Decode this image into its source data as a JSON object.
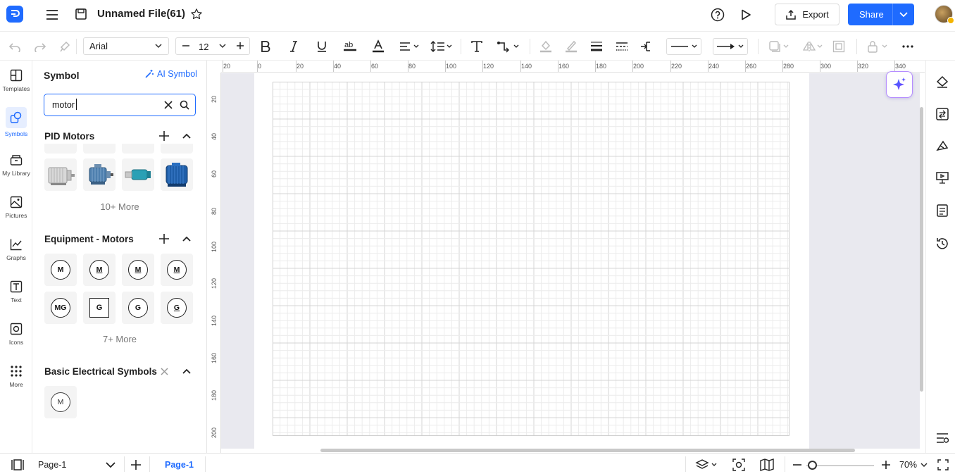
{
  "header": {
    "file_title": "Unnamed File(61)",
    "export_label": "Export",
    "share_label": "Share"
  },
  "toolbar": {
    "font": "Arial",
    "font_size": "12"
  },
  "left_rail": [
    {
      "label": "Templates",
      "icon": "templates-icon"
    },
    {
      "label": "Symbols",
      "icon": "symbols-icon",
      "active": true
    },
    {
      "label": "My Library",
      "icon": "library-icon"
    },
    {
      "label": "Pictures",
      "icon": "pictures-icon"
    },
    {
      "label": "Graphs",
      "icon": "graphs-icon"
    },
    {
      "label": "Text",
      "icon": "text-icon"
    },
    {
      "label": "Icons",
      "icon": "icons-icon"
    },
    {
      "label": "More",
      "icon": "more-icon"
    }
  ],
  "symbol_panel": {
    "title": "Symbol",
    "ai_symbol_label": "AI Symbol",
    "search_value": "motor",
    "sections": [
      {
        "title": "PID Motors",
        "more": "10+ More"
      },
      {
        "title": "Equipment - Motors",
        "more": "7+ More",
        "symbols": [
          "M",
          "M",
          "M",
          "M",
          "MG",
          "G",
          "G",
          "G"
        ]
      },
      {
        "title": "Basic Electrical Symbols",
        "symbols": [
          "M"
        ]
      }
    ]
  },
  "ruler": {
    "top": [
      "20",
      "0",
      "20",
      "40",
      "60",
      "80",
      "100",
      "120",
      "140",
      "160",
      "180",
      "200",
      "220",
      "240",
      "260",
      "280",
      "300",
      "320",
      "340"
    ],
    "left": [
      "20",
      "40",
      "60",
      "80",
      "100",
      "120",
      "140",
      "160",
      "180",
      "200"
    ]
  },
  "bottombar": {
    "page_select": "Page-1",
    "page_tab": "Page-1",
    "zoom": "70%"
  },
  "colors": {
    "accent": "#1f6bff",
    "workspace": "#e9e9ef",
    "ai_border": "#b58cff"
  }
}
